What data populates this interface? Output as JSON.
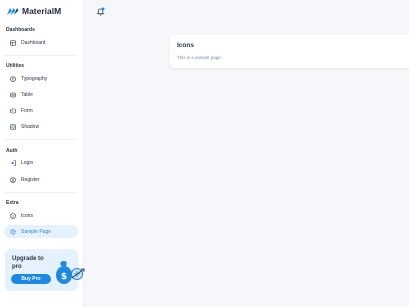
{
  "brand": {
    "name": "MaterialM"
  },
  "sections": {
    "dashboards": "Dashboards",
    "utilities": "Utilities",
    "auth": "Auth",
    "extra": "Extra"
  },
  "nav": {
    "dashboard": {
      "label": "Dashboard",
      "icon": "layout-icon"
    },
    "typography": {
      "label": "Typography",
      "icon": "typography-icon"
    },
    "table": {
      "label": "Table",
      "icon": "table-icon"
    },
    "form": {
      "label": "Form",
      "icon": "form-icon"
    },
    "shadow": {
      "label": "Shadow",
      "icon": "shadow-icon"
    },
    "login": {
      "label": "Login",
      "icon": "login-icon"
    },
    "register": {
      "label": "Register",
      "icon": "register-icon"
    },
    "icons": {
      "label": "Icons",
      "icon": "smiley-icon"
    },
    "sample_page": {
      "label": "Sample Page",
      "icon": "aperture-icon",
      "active": true
    }
  },
  "upgrade": {
    "title": "Upgrade to pro",
    "button": "Buy Pro"
  },
  "page": {
    "card_title": "Icons",
    "card_description": "This is a sample page"
  },
  "colors": {
    "primary": "#1e88e5",
    "active_bg": "#e5f1fc",
    "text": "#2a3547",
    "muted": "#7c8fac",
    "background": "#f5f7fa"
  }
}
